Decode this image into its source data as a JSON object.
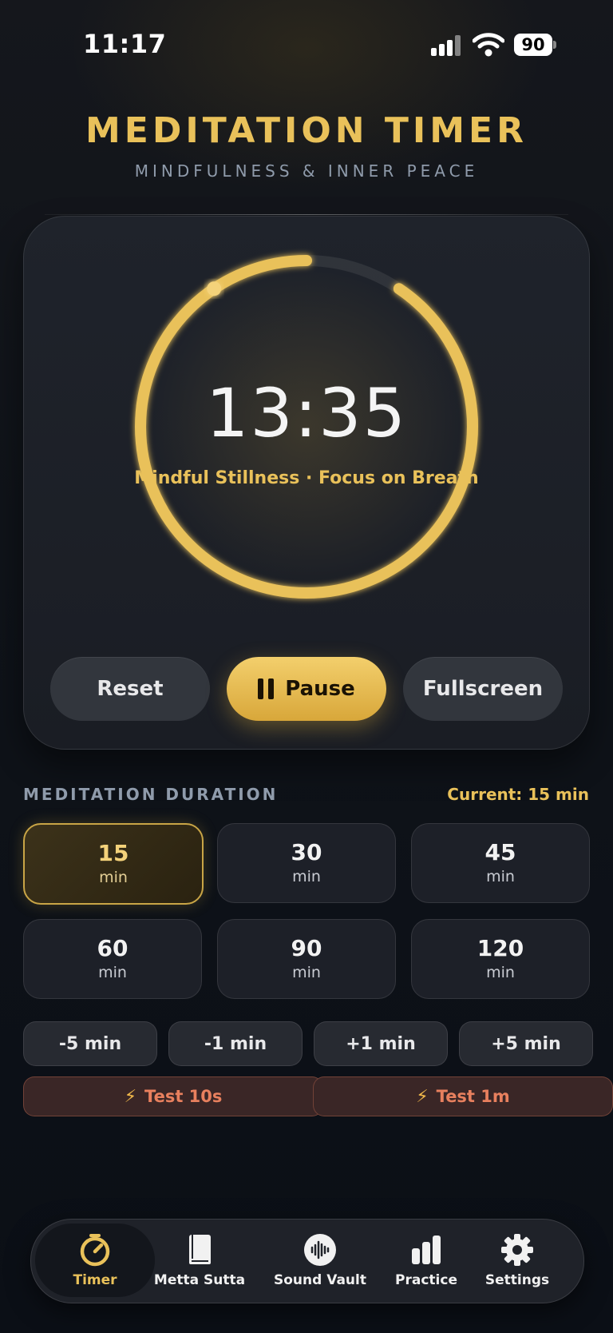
{
  "status_bar": {
    "time": "11:17",
    "battery": "90"
  },
  "header": {
    "title": "MEDITATION TIMER",
    "subtitle": "MINDFULNESS & INNER PEACE"
  },
  "timer": {
    "remaining": "13:35",
    "session_label": "Mindful Stillness · Focus on Breath",
    "progress_elapsed_fraction": 0.094,
    "accent_color": "#e9c15a",
    "buttons": {
      "reset": "Reset",
      "pause": "Pause",
      "fullscreen": "Fullscreen"
    }
  },
  "duration": {
    "label": "MEDITATION DURATION",
    "current": "Current: 15 min",
    "options": [
      {
        "value": "15",
        "unit": "min",
        "selected": true
      },
      {
        "value": "30",
        "unit": "min"
      },
      {
        "value": "45",
        "unit": "min"
      },
      {
        "value": "60",
        "unit": "min"
      },
      {
        "value": "90",
        "unit": "min"
      },
      {
        "value": "120",
        "unit": "min"
      }
    ],
    "adjust": [
      "-5 min",
      "-1 min",
      "+1 min",
      "+5 min"
    ],
    "tests": [
      "Test 10s",
      "Test 1m"
    ]
  },
  "nav": {
    "items": [
      {
        "label": "Timer",
        "icon": "timer-icon",
        "active": true
      },
      {
        "label": "Metta Sutta",
        "icon": "book-icon"
      },
      {
        "label": "Sound Vault",
        "icon": "sound-wave-icon"
      },
      {
        "label": "Practice",
        "icon": "bar-chart-icon"
      },
      {
        "label": "Settings",
        "icon": "gear-icon"
      }
    ]
  }
}
